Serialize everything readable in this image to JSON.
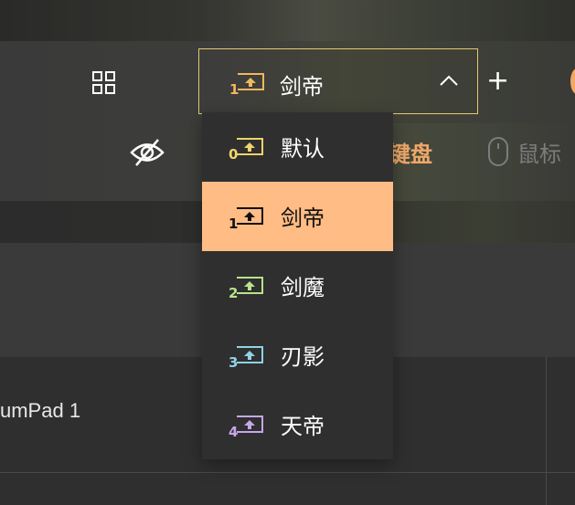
{
  "toolbar": {
    "current_profile": {
      "number": "1",
      "label": "剑帝"
    },
    "plus_label": "+"
  },
  "tabs": {
    "keyboard": "键盘",
    "mouse": "鼠标"
  },
  "dropdown": {
    "items": [
      {
        "number": "0",
        "label": "默认",
        "color": "#f2d36b"
      },
      {
        "number": "1",
        "label": "剑帝",
        "color": "#111111"
      },
      {
        "number": "2",
        "label": "剑魔",
        "color": "#b9e28c"
      },
      {
        "number": "3",
        "label": "刃影",
        "color": "#8fd3e6"
      },
      {
        "number": "4",
        "label": "天帝",
        "color": "#c7a6e8"
      }
    ],
    "selected_index": 1
  },
  "table": {
    "row_label": "umPad 1"
  },
  "colors": {
    "accent": "#f0a868",
    "selected_bg": "#ffbc85",
    "selector_border": "#e6c872",
    "profile1_icon": "#f2b75e"
  },
  "icons": {
    "grid": "grid-icon",
    "chevron": "chevron-up-icon",
    "eye": "eye-off-icon",
    "mouse": "mouse-icon",
    "profile": "profile-upload-icon"
  }
}
